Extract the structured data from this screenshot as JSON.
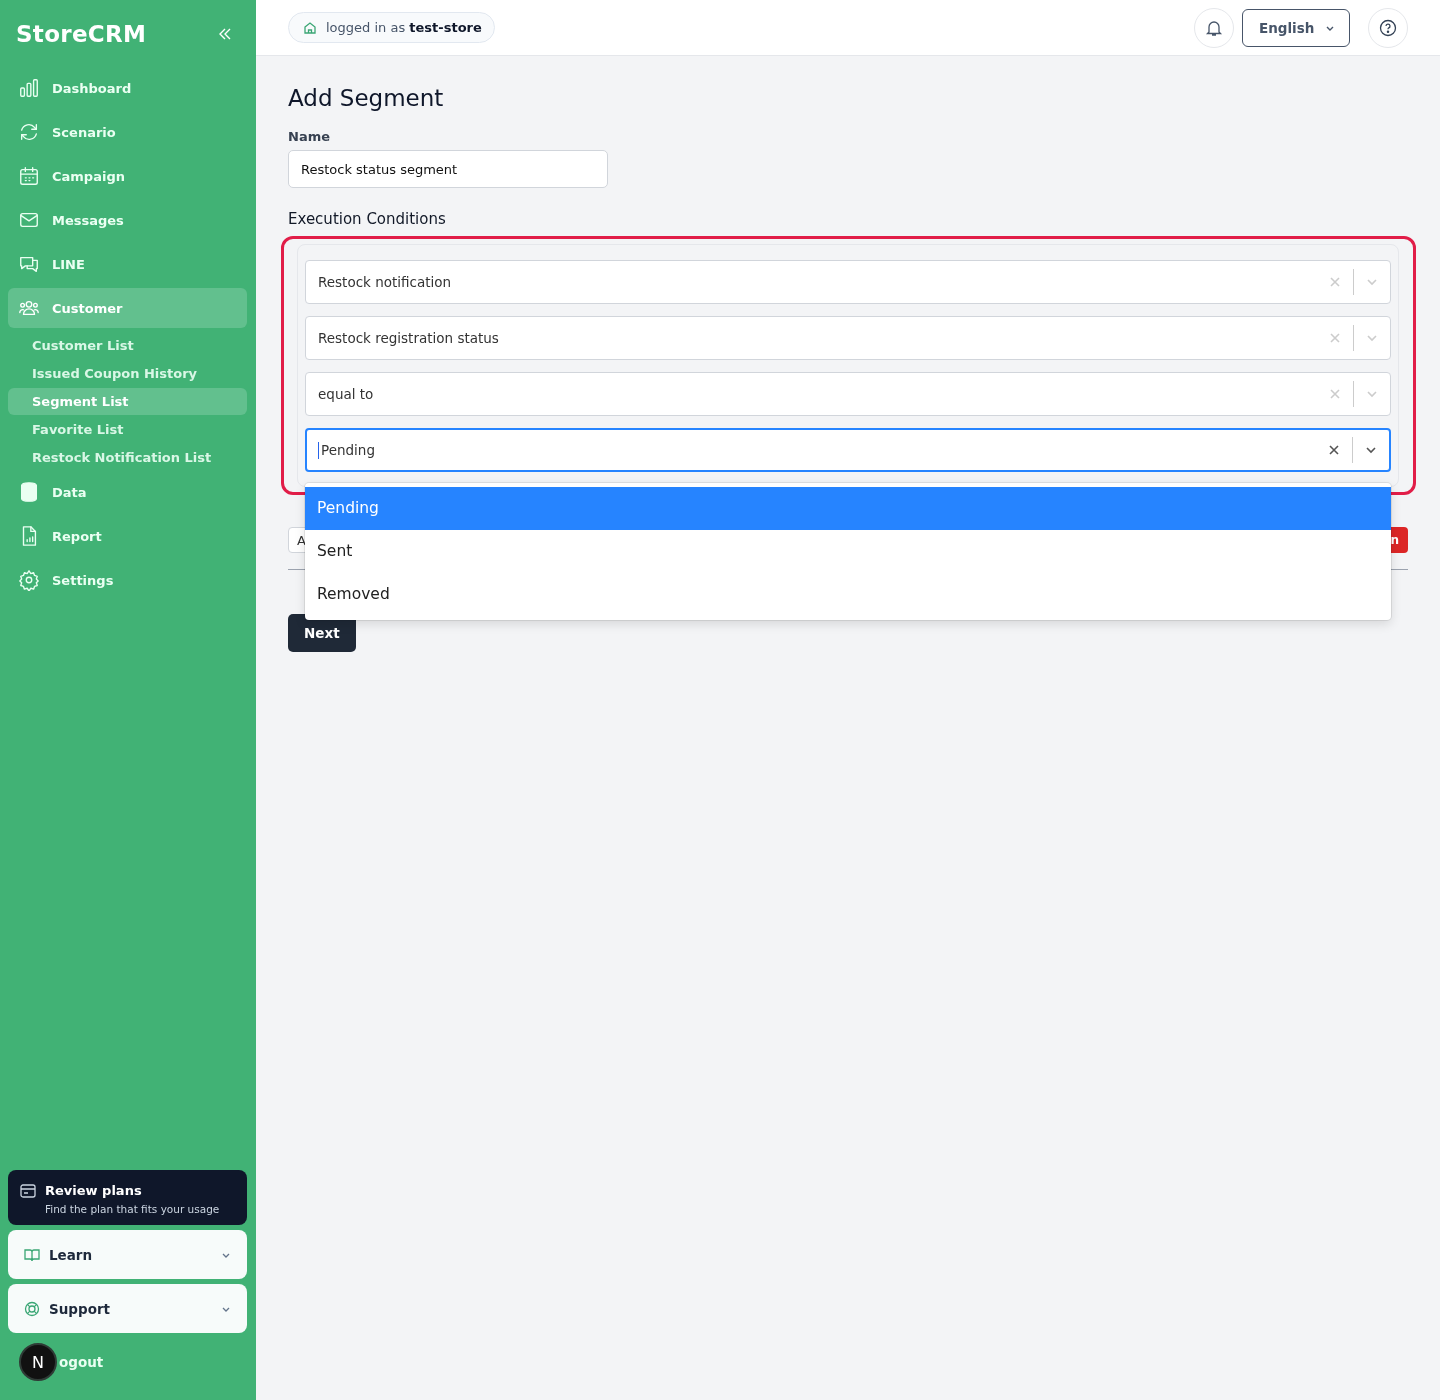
{
  "sidebar": {
    "logo": "StoreCRM",
    "items": [
      {
        "label": "Dashboard",
        "selected": false
      },
      {
        "label": "Scenario",
        "selected": false
      },
      {
        "label": "Campaign",
        "selected": false
      },
      {
        "label": "Messages",
        "selected": false
      },
      {
        "label": "LINE",
        "selected": false
      },
      {
        "label": "Customer",
        "selected": true,
        "children": [
          {
            "label": "Customer List",
            "selected": false
          },
          {
            "label": "Issued Coupon History",
            "selected": false
          },
          {
            "label": "Segment List",
            "selected": true
          },
          {
            "label": "Favorite List",
            "selected": false
          },
          {
            "label": "Restock Notification List",
            "selected": false
          }
        ]
      },
      {
        "label": "Data",
        "selected": false
      },
      {
        "label": "Report",
        "selected": false
      },
      {
        "label": "Settings",
        "selected": false
      }
    ],
    "plan_card": {
      "title": "Review plans",
      "subtitle": "Find the plan that fits your usage"
    },
    "panels": [
      {
        "label": "Learn",
        "expanded": false
      },
      {
        "label": "Support",
        "expanded": false
      }
    ],
    "logout": "ogout",
    "dev_badge": "N"
  },
  "header": {
    "login_badge": "logged in as **test-store**",
    "language": "English"
  },
  "page": {
    "title": "Add Segment",
    "name_field": {
      "label": "Name",
      "value": "Restock status segment"
    },
    "conditions": {
      "label": "Execution Conditions",
      "selects": [
        {
          "value": "Restock notification",
          "focused": false
        },
        {
          "value": "Restock registration status",
          "focused": false
        },
        {
          "value": "equal to",
          "focused": false
        },
        {
          "value": "Pending",
          "focused": true
        }
      ],
      "dropdown": [
        {
          "label": "Pending",
          "selected": true
        },
        {
          "label": "Sent",
          "selected": false
        },
        {
          "label": "Removed",
          "selected": false
        }
      ]
    },
    "add_button": "A",
    "delete_button": "n",
    "next_button": "Next"
  }
}
